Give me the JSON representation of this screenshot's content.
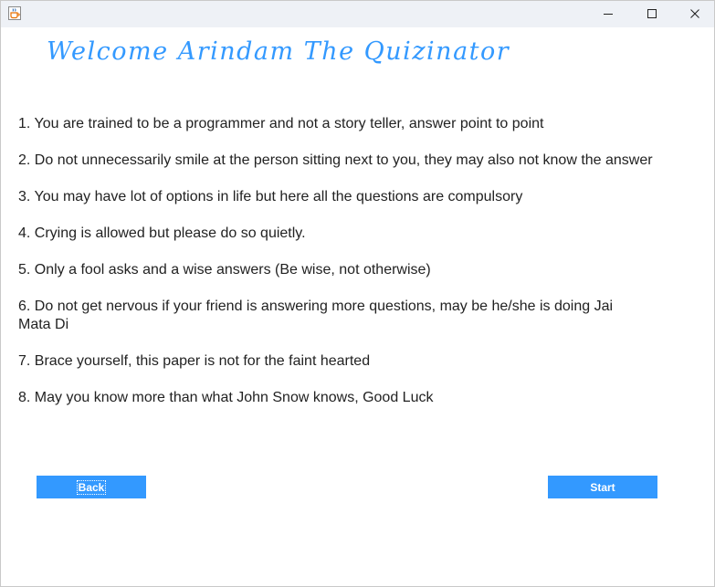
{
  "window": {
    "icon": "java-cup-icon",
    "controls": [
      "minimize-icon",
      "maximize-icon",
      "close-icon"
    ]
  },
  "heading": "Welcome Arindam The Quizinator",
  "rules": [
    "1. You are trained to be a programmer and not a story teller, answer point to point",
    "2. Do not unnecessarily smile at the person sitting next to you, they may also not know the answer",
    "3. You may have lot of options in life but here all the questions are compulsory",
    "4. Crying is allowed but please do so quietly.",
    "5. Only a fool asks and a wise answers (Be wise, not otherwise)",
    "6. Do not get nervous if your friend is answering more questions, may be he/she is doing Jai Mata Di",
    "7. Brace yourself, this paper is not for the faint hearted",
    "8. May you know more than what John Snow knows, Good Luck"
  ],
  "buttons": {
    "back": "Back",
    "start": "Start"
  },
  "colors": {
    "accent": "#3399ff",
    "text": "#222222",
    "titlebar": "#eef1f6"
  }
}
